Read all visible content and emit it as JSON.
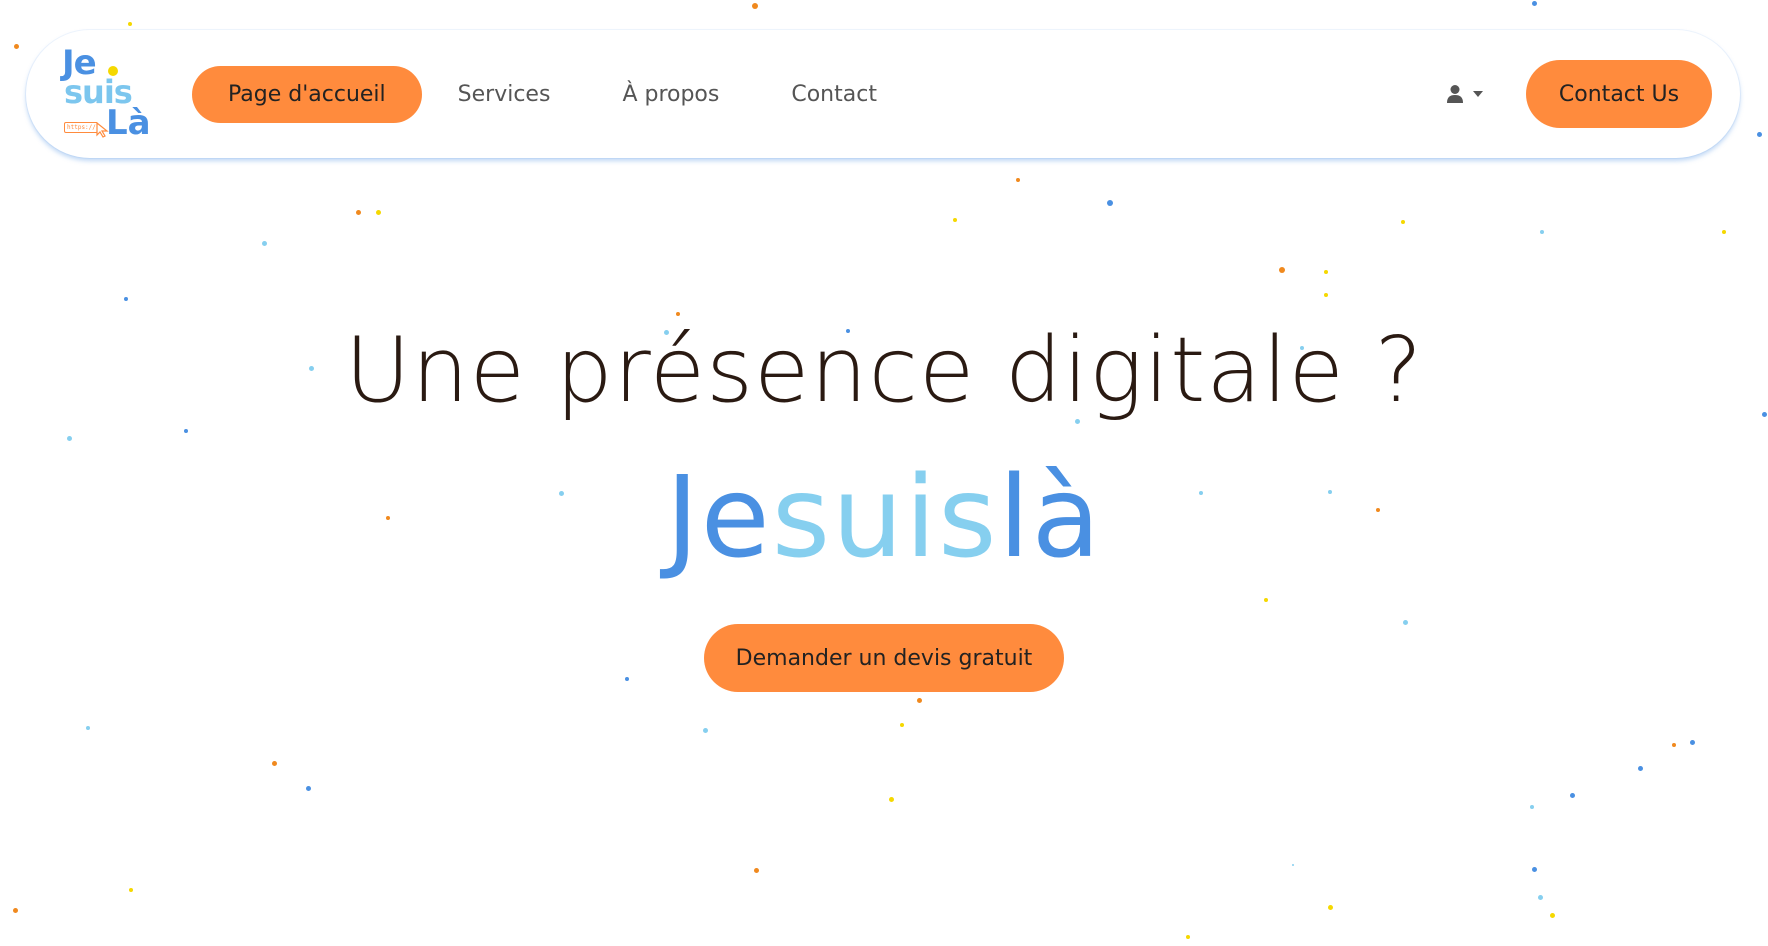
{
  "logo": {
    "line1": "Je",
    "line2": "suis",
    "line3": "Là",
    "url_hint": "https://"
  },
  "nav": {
    "items": [
      {
        "label": "Page d'accueil",
        "active": true
      },
      {
        "label": "Services",
        "active": false
      },
      {
        "label": "À propos",
        "active": false
      },
      {
        "label": "Contact",
        "active": false
      }
    ],
    "contact_button": "Contact Us"
  },
  "hero": {
    "headline": "Une présence  digitale ?",
    "brand_part1": "Je",
    "brand_part2": "suis",
    "brand_part3": "là",
    "cta_label": "Demander un devis gratuit"
  },
  "colors": {
    "accent_orange": "#ff8b3d",
    "brand_blue": "#4a90e2",
    "brand_light_blue": "#86cfef",
    "dot_yellow": "#f5d800"
  },
  "icons": {
    "user_menu": "user-icon",
    "user_menu_caret": "caret-down-icon"
  }
}
